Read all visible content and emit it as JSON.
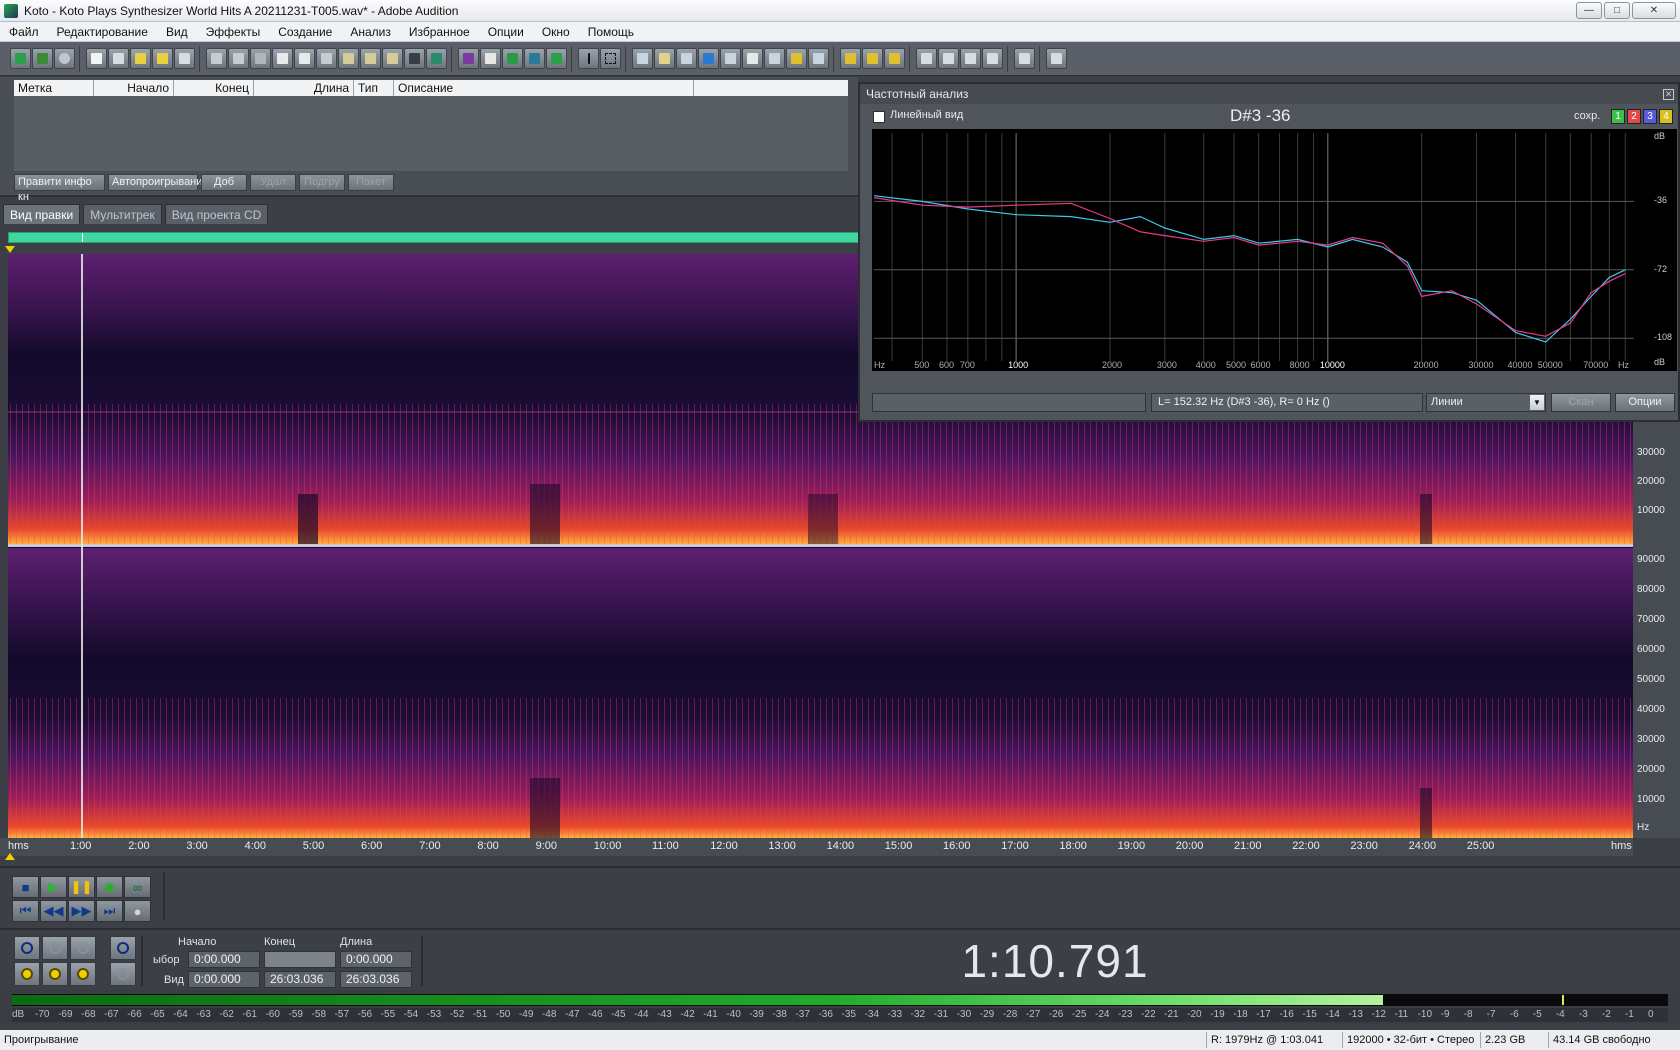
{
  "window": {
    "title": "Koto - Koto Plays Synthesizer World Hits  A 20211231-T005.wav* - Adobe Audition",
    "minimize": "—",
    "maximize": "□",
    "close": "✕"
  },
  "menu": [
    "Файл",
    "Редактирование",
    "Вид",
    "Эффекты",
    "Создание",
    "Анализ",
    "Избранное",
    "Опции",
    "Окно",
    "Помощь"
  ],
  "cue_list": {
    "columns": [
      "Метка",
      "Начало",
      "Конец",
      "Длина",
      "Тип",
      "Описание"
    ],
    "buttons": [
      {
        "label": "Правити инфо кн",
        "enabled": true
      },
      {
        "label": "Автопроигрывани",
        "enabled": true
      },
      {
        "label": "Доб",
        "enabled": true
      },
      {
        "label": "Удал",
        "enabled": false
      },
      {
        "label": "Подгру",
        "enabled": false
      },
      {
        "label": "Пакет",
        "enabled": false
      }
    ]
  },
  "view_tabs": [
    {
      "label": "Вид правки",
      "active": true
    },
    {
      "label": "Мультитрек",
      "active": false
    },
    {
      "label": "Вид проекта CD",
      "active": false
    }
  ],
  "hz_scale": {
    "unit": "Hz",
    "left_channel": [
      "30000",
      "20000",
      "10000"
    ],
    "right_channel": [
      "90000",
      "80000",
      "70000",
      "60000",
      "50000",
      "40000",
      "30000",
      "20000",
      "10000"
    ]
  },
  "time_ruler": {
    "start_label": "hms",
    "end_label": "hms",
    "labels": [
      "1:00",
      "2:00",
      "3:00",
      "4:00",
      "5:00",
      "6:00",
      "7:00",
      "8:00",
      "9:00",
      "10:00",
      "11:00",
      "12:00",
      "13:00",
      "14:00",
      "15:00",
      "16:00",
      "17:00",
      "18:00",
      "19:00",
      "20:00",
      "21:00",
      "22:00",
      "23:00",
      "24:00",
      "25:00"
    ]
  },
  "selection": {
    "headers": {
      "start": "Начало",
      "end": "Конец",
      "length": "Длина"
    },
    "rows": {
      "selection": "ыбор",
      "view": "Вид"
    },
    "selection_values": {
      "start": "0:00.000",
      "end": "",
      "length": "0:00.000"
    },
    "view_values": {
      "start": "0:00.000",
      "end": "26:03.036",
      "length": "26:03.036"
    }
  },
  "time_display": "1:10.791",
  "level_meter": {
    "level_fraction": 0.828,
    "peak_fraction": 0.936,
    "labels": [
      "dB",
      "-70",
      "-69",
      "-68",
      "-67",
      "-66",
      "-65",
      "-64",
      "-63",
      "-62",
      "-61",
      "-60",
      "-59",
      "-58",
      "-57",
      "-56",
      "-55",
      "-54",
      "-53",
      "-52",
      "-51",
      "-50",
      "-49",
      "-48",
      "-47",
      "-46",
      "-45",
      "-44",
      "-43",
      "-42",
      "-41",
      "-40",
      "-39",
      "-38",
      "-37",
      "-36",
      "-35",
      "-34",
      "-33",
      "-32",
      "-31",
      "-30",
      "-29",
      "-28",
      "-27",
      "-26",
      "-25",
      "-24",
      "-23",
      "-22",
      "-21",
      "-20",
      "-19",
      "-18",
      "-17",
      "-16",
      "-15",
      "-14",
      "-13",
      "-12",
      "-11",
      "-10",
      "-9",
      "-8",
      "-7",
      "-6",
      "-5",
      "-4",
      "-3",
      "-2",
      "-1",
      "0"
    ]
  },
  "status": {
    "state": "Проигрывание",
    "cursor": "R: 1979Hz @   1:03.041",
    "format": "192000 • 32-бит • Стерео",
    "size": "2.23 GB",
    "free": "43.14 GB свободно"
  },
  "freq_analysis": {
    "title": "Частотный анализ",
    "linear_label": "Линейный вид",
    "linear_checked": false,
    "note": "D#3 -36",
    "save_label": "сохр.",
    "slots": [
      {
        "label": "1",
        "color": "#3bbf4a"
      },
      {
        "label": "2",
        "color": "#e04a4a"
      },
      {
        "label": "3",
        "color": "#5a5ad8"
      },
      {
        "label": "4",
        "color": "#d8c020"
      }
    ],
    "readout": "L= 152.32 Hz (D#3 -36), R=     0 Hz ()",
    "display_mode": "Линии",
    "scan_label": "Скан",
    "options_label": "Опции",
    "chart_data": {
      "type": "line",
      "x_scale": "log",
      "xlim": [
        350,
        96000
      ],
      "ylim": [
        -120,
        0
      ],
      "x_tick_labels": [
        "Hz",
        "500",
        "600",
        "700",
        "1000",
        "2000",
        "3000",
        "4000",
        "5000",
        "6000",
        "8000",
        "10000",
        "20000",
        "30000",
        "40000",
        "50000",
        "70000",
        "Hz"
      ],
      "y_tick_labels": [
        "dB",
        "-36",
        "-72",
        "-108",
        "dB"
      ],
      "series": [
        {
          "color": "#3fc8e8",
          "x": [
            350,
            500,
            700,
            1000,
            1500,
            2000,
            2500,
            3000,
            4000,
            5000,
            6000,
            8000,
            10000,
            12000,
            15000,
            18000,
            20000,
            25000,
            30000,
            40000,
            50000,
            60000,
            70000,
            80000,
            90000
          ],
          "y": [
            -33,
            -36,
            -40,
            -43,
            -44,
            -47,
            -44,
            -50,
            -56,
            -54,
            -58,
            -56,
            -60,
            -56,
            -60,
            -68,
            -83,
            -84,
            -88,
            -105,
            -110,
            -98,
            -86,
            -76,
            -72
          ]
        },
        {
          "color": "#e83a8a",
          "x": [
            350,
            500,
            700,
            1000,
            1500,
            2000,
            2500,
            3000,
            4000,
            5000,
            6000,
            8000,
            10000,
            12000,
            15000,
            18000,
            20000,
            25000,
            30000,
            40000,
            50000,
            60000,
            70000,
            80000,
            90000
          ],
          "y": [
            -34,
            -38,
            -39,
            -38,
            -37,
            -45,
            -52,
            -54,
            -57,
            -55,
            -59,
            -57,
            -59,
            -55,
            -58,
            -70,
            -86,
            -83,
            -90,
            -104,
            -107,
            -100,
            -84,
            -78,
            -74
          ]
        }
      ]
    }
  },
  "colors": {
    "accent": "#3fd6a0",
    "playhead": "#e8e8e8",
    "spectrogram_low": "#0c0820",
    "spectrogram_mid": "#6a1f7a",
    "spectrogram_high": "#ff5a1a"
  }
}
